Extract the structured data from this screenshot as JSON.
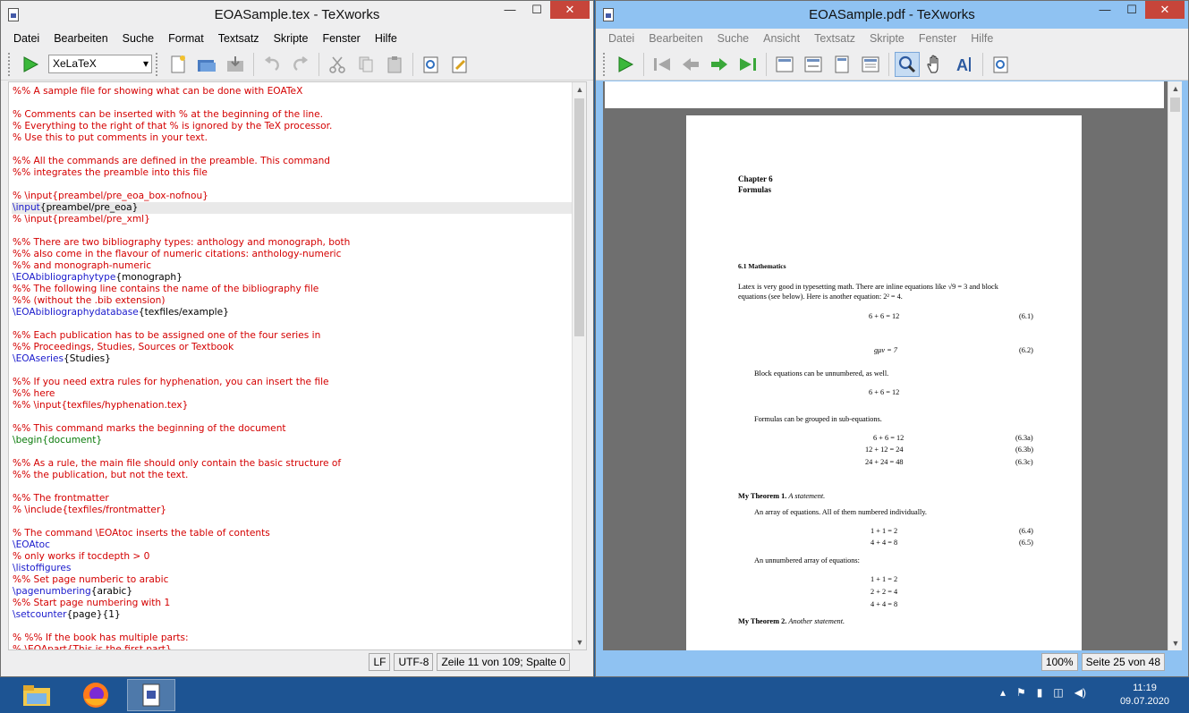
{
  "left_window": {
    "title": "EOASample.tex - TeXworks",
    "menu": [
      "Datei",
      "Bearbeiten",
      "Suche",
      "Format",
      "Textsatz",
      "Skripte",
      "Fenster",
      "Hilfe"
    ],
    "engine": "XeLaTeX",
    "status": {
      "line_ending": "LF",
      "encoding": "UTF-8",
      "position": "Zeile 11 von 109; Spalte 0"
    }
  },
  "editor_lines": [
    {
      "t": "%% A sample file for showing what can be done with EOATeX",
      "k": "c"
    },
    {
      "t": "",
      "k": "c"
    },
    {
      "t": "% Comments can be inserted with % at the beginning of the line.",
      "k": "c"
    },
    {
      "t": "% Everything to the right of that % is ignored by the TeX processor.",
      "k": "c"
    },
    {
      "t": "% Use this to put comments in your text.",
      "k": "c"
    },
    {
      "t": "",
      "k": "c"
    },
    {
      "t": "%% All the commands are defined in the preamble. This command",
      "k": "c"
    },
    {
      "t": "%% integrates the preamble into this file",
      "k": "c"
    },
    {
      "t": "",
      "k": "c"
    },
    {
      "t": "% \\input{preambel/pre_eoa_box-nofnou}",
      "k": "c"
    },
    {
      "cmd": "\\input",
      "arg": "{preambel/pre_eoa}",
      "k": "cur"
    },
    {
      "t": "% \\input{preambel/pre_xml}",
      "k": "c"
    },
    {
      "t": "",
      "k": "c"
    },
    {
      "t": "%% There are two bibliography types: anthology and monograph, both",
      "k": "c"
    },
    {
      "t": "%% also come in the flavour of numeric citations: anthology-numeric",
      "k": "c"
    },
    {
      "t": "%% and monograph-numeric",
      "k": "c"
    },
    {
      "cmd": "\\EOAbibliographytype",
      "arg": "{monograph}",
      "k": "cmd"
    },
    {
      "t": "%% The following line contains the name of the bibliography file",
      "k": "c"
    },
    {
      "t": "%% (without the .bib extension)",
      "k": "c"
    },
    {
      "cmd": "\\EOAbibliographydatabase",
      "arg": "{texfiles/example}",
      "k": "cmd"
    },
    {
      "t": "",
      "k": "c"
    },
    {
      "t": "%% Each publication has to be assigned one of the four series in",
      "k": "c"
    },
    {
      "t": "%% Proceedings, Studies, Sources or Textbook",
      "k": "c"
    },
    {
      "cmd": "\\EOAseries",
      "arg": "{Studies}",
      "k": "cmd"
    },
    {
      "t": "",
      "k": "c"
    },
    {
      "t": "%% If you need extra rules for hyphenation, you can insert the file",
      "k": "c"
    },
    {
      "t": "%% here",
      "k": "c"
    },
    {
      "t": "%% \\input{texfiles/hyphenation.tex}",
      "k": "c"
    },
    {
      "t": "",
      "k": "c"
    },
    {
      "t": "%% This command marks the beginning of the document",
      "k": "c"
    },
    {
      "cmd": "\\begin",
      "arg": "{document}",
      "k": "begin"
    },
    {
      "t": "",
      "k": "c"
    },
    {
      "t": "%% As a rule, the main file should only contain the basic structure of",
      "k": "c"
    },
    {
      "t": "%% the publication, but not the text.",
      "k": "c"
    },
    {
      "t": "",
      "k": "c"
    },
    {
      "t": "%% The frontmatter",
      "k": "c"
    },
    {
      "t": "% \\include{texfiles/frontmatter}",
      "k": "c"
    },
    {
      "t": "",
      "k": "c"
    },
    {
      "t": "% The command \\EOAtoc inserts the table of contents",
      "k": "c"
    },
    {
      "cmd": "\\EOAtoc",
      "arg": "",
      "k": "cmd"
    },
    {
      "t": "% only works if tocdepth > 0",
      "k": "c"
    },
    {
      "cmd": "\\listoffigures",
      "arg": "",
      "k": "cmd"
    },
    {
      "t": "%% Set page numberic to arabic",
      "k": "c"
    },
    {
      "cmd": "\\pagenumbering",
      "arg": "{arabic}",
      "k": "cmd"
    },
    {
      "t": "%% Start page numbering with 1",
      "k": "c"
    },
    {
      "cmd": "\\setcounter",
      "arg": "{page}{1}",
      "k": "cmd"
    },
    {
      "t": "",
      "k": "c"
    },
    {
      "t": "% %% If the book has multiple parts:",
      "k": "c"
    },
    {
      "t": "% \\EOApart{This is the first part}",
      "k": "c"
    }
  ],
  "right_window": {
    "title": "EOASample.pdf - TeXworks",
    "menu": [
      "Datei",
      "Bearbeiten",
      "Suche",
      "Ansicht",
      "Textsatz",
      "Skripte",
      "Fenster",
      "Hilfe"
    ],
    "status": {
      "zoom": "100%",
      "page": "Seite 25 von 48"
    }
  },
  "pdf": {
    "chapter": "Chapter 6",
    "chapter_title": "Formulas",
    "section": "6.1    Mathematics",
    "para1a": "Latex is very good in typesetting math.  There are inline equations like √9 = 3 and block",
    "para1b": "equations (see below).  Here is another equation: 2² = 4.",
    "eq1": "6 + 6 = 12",
    "eq1n": "(6.1)",
    "eq2": "gμν = 7",
    "eq2n": "(6.2)",
    "para2": "Block equations can be unnumbered, as well.",
    "eq3": "6 + 6 = 12",
    "para3": "Formulas can be grouped in sub-equations.",
    "eq4": "6 + 6 = 12",
    "eq4n": "(6.3a)",
    "eq5": "12 + 12 = 24",
    "eq5n": "(6.3b)",
    "eq6": "24 + 24 = 48",
    "eq6n": "(6.3c)",
    "thm1": "My Theorem 1.",
    "thm1i": "A statement.",
    "para4": "An array of equations.  All of them numbered individually.",
    "eq7": "1 + 1 = 2",
    "eq7n": "(6.4)",
    "eq8": "4 + 4 = 8",
    "eq8n": "(6.5)",
    "para5": "An unnumbered array of equations:",
    "eq9": "1 + 1 = 2",
    "eq10": "2 + 2 = 4",
    "eq11": "4 + 4 = 8",
    "thm2": "My Theorem 2.",
    "thm2i": "Another statement."
  },
  "taskbar": {
    "time": "11:19",
    "date": "09.07.2020"
  }
}
